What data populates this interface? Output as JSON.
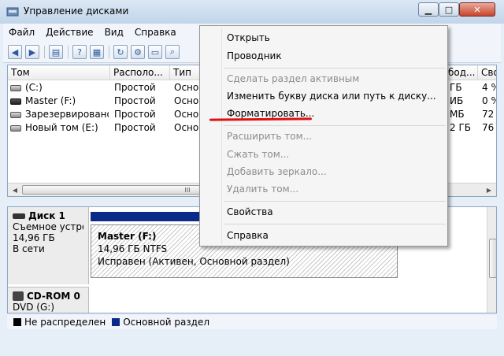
{
  "window": {
    "title": "Управление дисками",
    "icon": "disk-management-icon",
    "controls": [
      "minimize-icon",
      "maximize-icon",
      "close-icon"
    ]
  },
  "menubar": [
    "Файл",
    "Действие",
    "Вид",
    "Справка"
  ],
  "toolbar": {
    "buttons": [
      "back-icon",
      "forward-icon",
      "console-tree-icon",
      "help-icon",
      "properties-icon",
      "refresh-icon",
      "settings-icon",
      "open-folder-icon",
      "search-icon"
    ]
  },
  "volume_table": {
    "columns": [
      "Том",
      "Располо...",
      "Тип",
      "",
      "",
      "",
      "",
      "бод...",
      "Сво"
    ],
    "rows": [
      {
        "name": "(C:)",
        "layout": "Простой",
        "type": "Основ",
        "free": "ГБ",
        "pct": "4 %"
      },
      {
        "name": "Master (F:)",
        "layout": "Простой",
        "type": "Основ",
        "free": "ИБ",
        "pct": "0 %"
      },
      {
        "name": "Зарезервировано...",
        "layout": "Простой",
        "type": "Основ",
        "free": "МБ",
        "pct": "72"
      },
      {
        "name": "Новый том (E:)",
        "layout": "Простой",
        "type": "Основ",
        "free": "2 ГБ",
        "pct": "76"
      }
    ],
    "scroll_marker": "III"
  },
  "disk_panel": {
    "disk1": {
      "name": "Диск 1",
      "type": "Съемное устро",
      "size": "14,96 ГБ",
      "status": "В сети"
    },
    "partition": {
      "label": "Master  (F:)",
      "size_fs": "14,96 ГБ NTFS",
      "status": "Исправен (Активен, Основной раздел)"
    },
    "cdrom": {
      "name": "CD-ROM 0",
      "drive": "DVD (G:)"
    }
  },
  "legend": {
    "unallocated": "Не распределен",
    "primary": "Основной раздел",
    "colors": {
      "unallocated": "#000000",
      "primary": "#0a2a8a"
    }
  },
  "context_menu": {
    "items": [
      {
        "label": "Открыть",
        "enabled": true
      },
      {
        "label": "Проводник",
        "enabled": true
      },
      {
        "label": "Сделать раздел активным",
        "enabled": false
      },
      {
        "label": "Изменить букву диска или путь к диску...",
        "enabled": true
      },
      {
        "label": "Форматировать...",
        "enabled": true,
        "highlighted": true
      },
      {
        "label": "Расширить том...",
        "enabled": false
      },
      {
        "label": "Сжать том...",
        "enabled": false
      },
      {
        "label": "Добавить зеркало...",
        "enabled": false
      },
      {
        "label": "Удалить том...",
        "enabled": false
      },
      {
        "label": "Свойства",
        "enabled": true
      },
      {
        "label": "Справка",
        "enabled": true
      }
    ],
    "highlight_color": "#e01010"
  }
}
